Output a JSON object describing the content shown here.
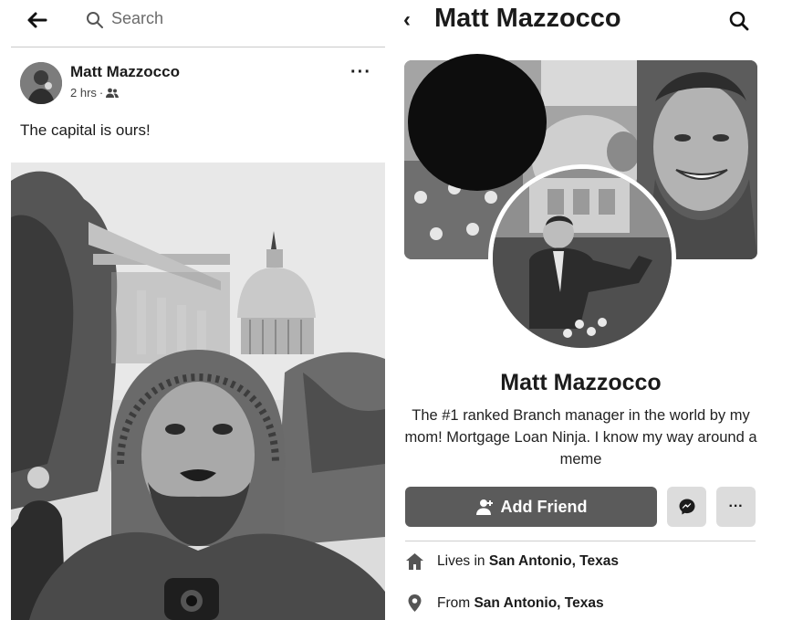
{
  "feed": {
    "search_placeholder": "Search",
    "post": {
      "author": "Matt Mazzocco",
      "time": "2 hrs",
      "separator": "·",
      "more": "···",
      "text": "The capital is ours!"
    }
  },
  "profile": {
    "header_title": "Matt Mazzocco",
    "name": "Matt Mazzocco",
    "bio": "The #1 ranked Branch manager in the world by my mom! Mortgage Loan Ninja. I know my way around a meme",
    "add_friend_label": "Add Friend",
    "more": "···",
    "intro": [
      {
        "icon": "home-icon",
        "prefix": "Lives in ",
        "place": "San Antonio, Texas"
      },
      {
        "icon": "location-pin-icon",
        "prefix": "From ",
        "place": "San Antonio, Texas"
      }
    ]
  },
  "colors": {
    "button_dark": "#5b5b5b",
    "button_light": "#dcdcdc",
    "text": "#1b1b1b"
  }
}
